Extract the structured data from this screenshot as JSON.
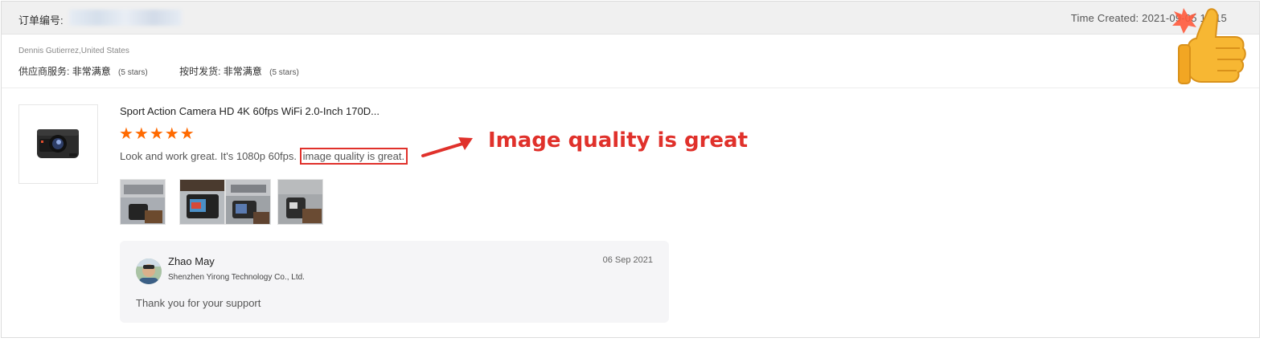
{
  "order": {
    "label": "订单编号:",
    "time_created": "Time Created: 2021-09-05 12:15"
  },
  "buyer": {
    "name_location": "Dennis Gutierrez,United States"
  },
  "ratings": [
    {
      "label": "供应商服务:",
      "value": "非常满意",
      "stars_text": "(5 stars)"
    },
    {
      "label": "按时发货:",
      "value": "非常满意",
      "stars_text": "(5 stars)"
    }
  ],
  "product": {
    "title": "Sport Action Camera HD 4K 60fps WiFi 2.0-Inch 170D...",
    "stars_glyphs": "★★★★★",
    "rating": 5,
    "review_prefix": "Look and work great. It's 1080p 60fps.",
    "review_highlight": "image quality is great."
  },
  "annotation": {
    "text": "Image quality is great",
    "color": "#e0312b"
  },
  "photos_count": 4,
  "reply": {
    "seller_name": "Zhao May",
    "company": "Shenzhen Yirong Technology Co., Ltd.",
    "date": "06 Sep 2021",
    "text": "Thank you for your support"
  },
  "colors": {
    "star": "#ff6a00",
    "highlight_border": "#e0312b",
    "header_bg": "#f0f0f0",
    "reply_bg": "#f5f5f7"
  },
  "icons": {
    "thumbs_up": "thumbs-up-emoji-icon",
    "arrow": "red-arrow-icon"
  }
}
